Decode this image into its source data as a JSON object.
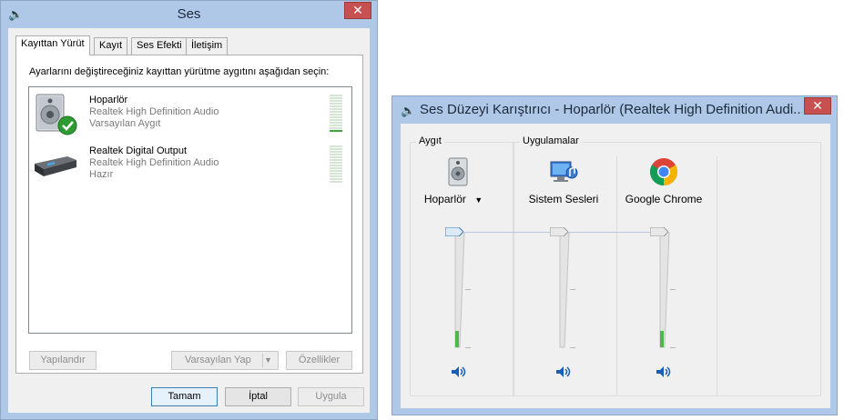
{
  "sound_dialog": {
    "title": "Ses",
    "tabs": [
      {
        "label": "Kayıttan Yürüt",
        "active": true
      },
      {
        "label": "Kayıt",
        "active": false
      },
      {
        "label": "Ses Efekti",
        "active": false
      },
      {
        "label": "İletişim",
        "active": false
      }
    ],
    "instruction": "Ayarlarını değiştireceğiniz kayıttan yürütme aygıtını aşağıdan seçin:",
    "devices": [
      {
        "name": "Hoparlör",
        "description": "Realtek High Definition Audio",
        "status": "Varsayılan Aygıt",
        "icon": "speaker-icon",
        "default": true
      },
      {
        "name": "Realtek Digital Output",
        "description": "Realtek High Definition Audio",
        "status": "Hazır",
        "icon": "digital-output-icon",
        "default": false
      }
    ],
    "buttons": {
      "configure": "Yapılandır",
      "set_default": "Varsayılan Yap",
      "properties": "Özellikler",
      "ok": "Tamam",
      "cancel": "İptal",
      "apply": "Uygula"
    }
  },
  "mixer": {
    "title": "Ses Düzeyi Karıştırıcı - Hoparlör (Realtek High Definition Audi...",
    "device_group_label": "Aygıt",
    "apps_group_label": "Uygulamalar",
    "channels": [
      {
        "label": "Hoparlör",
        "icon": "speaker-icon",
        "volume_percent": 100,
        "level_percent": 15,
        "has_dropdown": true
      },
      {
        "label": "Sistem Sesleri",
        "icon": "system-sounds-icon",
        "volume_percent": 100,
        "level_percent": 0,
        "has_dropdown": false
      },
      {
        "label": "Google Chrome",
        "icon": "chrome-icon",
        "volume_percent": 100,
        "level_percent": 15,
        "has_dropdown": false
      }
    ]
  }
}
